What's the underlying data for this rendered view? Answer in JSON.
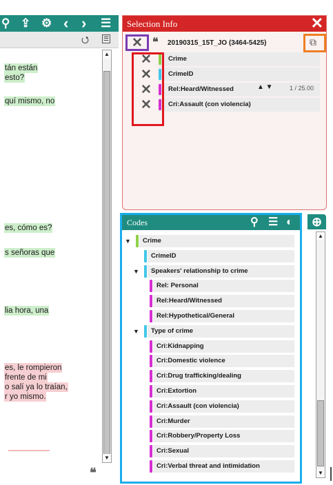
{
  "toolbar": {
    "icons": [
      "search-icon",
      "upload-icon",
      "gear-icon",
      "chevron-left-icon",
      "chevron-right-icon",
      "list-icon"
    ],
    "glyphs": {
      "search": "⚲",
      "upload": "⇪",
      "gear": "⚙",
      "prev": "‹",
      "next": "›",
      "list": "☰"
    }
  },
  "transcript": {
    "lines": [
      {
        "text": "tán están",
        "highlight": "green"
      },
      {
        "text": " esto?",
        "highlight": "green"
      },
      {
        "text": "quí mismo, no",
        "highlight": "green"
      },
      {
        "text": "es, cómo es?",
        "highlight": "green"
      },
      {
        "text": "s señoras que",
        "highlight": "green"
      },
      {
        "text": "lia hora, una",
        "highlight": "green"
      },
      {
        "text": "es, le rompieron",
        "highlight": "red"
      },
      {
        "text": "frente de mi",
        "highlight": "red"
      },
      {
        "text": "o salí ya lo traían,",
        "highlight": "red"
      },
      {
        "text": "r yo mismo.",
        "highlight": "red"
      }
    ],
    "quote_glyph": "❝"
  },
  "selection_info": {
    "title": "Selection Info",
    "close_glyph": "✕",
    "document_name": "20190315_15T_JO (3464-5425)",
    "quote_glyph": "❝",
    "remove_glyph": "✕",
    "pin_glyph": "⧉",
    "codes": [
      {
        "label": "Crime",
        "color": "#8ed14a"
      },
      {
        "label": "CrimeID",
        "color": "#42c6e8"
      },
      {
        "label": "Rel:Heard/Witnessed",
        "color": "#d62fd2"
      },
      {
        "label": "Cri:Assault (con violencia)",
        "color": "#d62fd2"
      }
    ],
    "nav_arrows": "▲ ▼",
    "count": "1 / 25.00"
  },
  "codes_panel": {
    "title": "Codes",
    "add_glyph": "⊕",
    "header_glyphs": {
      "search": "⚲",
      "filter": "☰",
      "info": "◐"
    },
    "tree": [
      {
        "label": "Crime",
        "color": "#8ed14a",
        "level": 0,
        "expanded": true
      },
      {
        "label": "CrimeID",
        "color": "#42c6e8",
        "level": 1,
        "expanded": null
      },
      {
        "label": "Speakers' relationship to crime",
        "color": "#42c6e8",
        "level": 1,
        "expanded": true
      },
      {
        "label": "Rel: Personal",
        "color": "#d62fd2",
        "level": 2,
        "expanded": null
      },
      {
        "label": "Rel:Heard/Witnessed",
        "color": "#d62fd2",
        "level": 2,
        "expanded": null
      },
      {
        "label": "Rel:Hypothetical/General",
        "color": "#d62fd2",
        "level": 2,
        "expanded": null
      },
      {
        "label": "Type of crime",
        "color": "#42c6e8",
        "level": 1,
        "expanded": true
      },
      {
        "label": "Cri:Kidnapping",
        "color": "#d62fd2",
        "level": 2,
        "expanded": null
      },
      {
        "label": "Cri:Domestic violence",
        "color": "#d62fd2",
        "level": 2,
        "expanded": null
      },
      {
        "label": "Cri:Drug trafficking/dealing",
        "color": "#d62fd2",
        "level": 2,
        "expanded": null
      },
      {
        "label": "Cri:Extortion",
        "color": "#d62fd2",
        "level": 2,
        "expanded": null
      },
      {
        "label": "Cri:Assault (con violencia)",
        "color": "#d62fd2",
        "level": 2,
        "expanded": null
      },
      {
        "label": "Cri:Murder",
        "color": "#d62fd2",
        "level": 2,
        "expanded": null
      },
      {
        "label": "Cri:Robbery/Property Loss",
        "color": "#d62fd2",
        "level": 2,
        "expanded": null
      },
      {
        "label": "Cri:Sexual",
        "color": "#d62fd2",
        "level": 2,
        "expanded": null
      },
      {
        "label": "Cri:Verbal threat and intimidation",
        "color": "#d62fd2",
        "level": 2,
        "expanded": null
      }
    ],
    "expand_glyph": "▼"
  },
  "annotation_colors": {
    "purple": "#7b3ab3",
    "red": "#e0161e",
    "orange": "#ef7f23",
    "blue": "#1aaeea"
  }
}
